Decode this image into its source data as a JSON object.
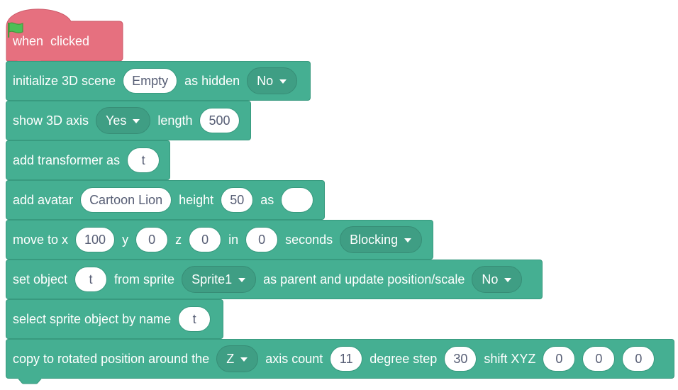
{
  "hat": {
    "when": "when",
    "clicked": "clicked",
    "icon": "green-flag-icon"
  },
  "b1": {
    "t1": "initialize 3D scene",
    "scene": "Empty",
    "t2": "as hidden",
    "hidden": "No"
  },
  "b2": {
    "t1": "show 3D axis",
    "axis": "Yes",
    "t2": "length",
    "length": "500"
  },
  "b3": {
    "t1": "add transformer as",
    "name": "t"
  },
  "b4": {
    "t1": "add avatar",
    "avatar": "Cartoon Lion",
    "t2": "height",
    "height": "50",
    "t3": "as",
    "as": ""
  },
  "b5": {
    "t1": "move to x",
    "x": "100",
    "t2": "y",
    "y": "0",
    "t3": "z",
    "z": "0",
    "t4": "in",
    "secs": "0",
    "t5": "seconds",
    "mode": "Blocking"
  },
  "b6": {
    "t1": "set object",
    "obj": "t",
    "t2": "from sprite",
    "sprite": "Sprite1",
    "t3": "as parent and update position/scale",
    "update": "No"
  },
  "b7": {
    "t1": "select sprite object by name",
    "name": "t"
  },
  "b8": {
    "t1": "copy to rotated position around the",
    "axis": "Z",
    "t2": "axis count",
    "count": "11",
    "t3": "degree step",
    "step": "30",
    "t4": "shift XYZ",
    "sx": "0",
    "sy": "0",
    "sz": "0"
  },
  "colors": {
    "event": "#E6707F",
    "extension": "#45AF92",
    "flag": "#4CBF56"
  }
}
